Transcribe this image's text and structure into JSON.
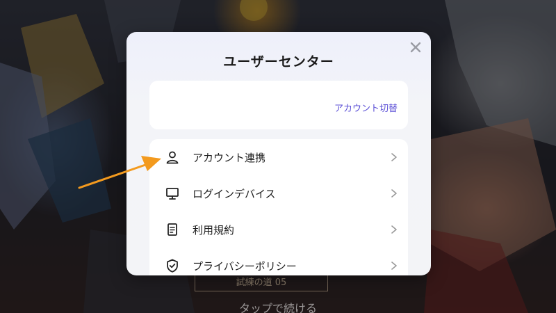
{
  "background": {
    "continue_text": "タップで続ける",
    "ribbon_text": "試練の道 05"
  },
  "modal": {
    "title": "ユーザーセンター",
    "close_icon": "close-icon",
    "account": {
      "switch_label": "アカウント切替"
    },
    "menu": [
      {
        "label": "アカウント連携",
        "icon": "user-icon"
      },
      {
        "label": "ログインデバイス",
        "icon": "monitor-icon"
      },
      {
        "label": "利用規約",
        "icon": "document-icon"
      },
      {
        "label": "プライバシーポリシー",
        "icon": "shield-check-icon"
      }
    ]
  },
  "colors": {
    "accent": "#5b4fd6",
    "annotation_arrow": "#f39a1e"
  }
}
